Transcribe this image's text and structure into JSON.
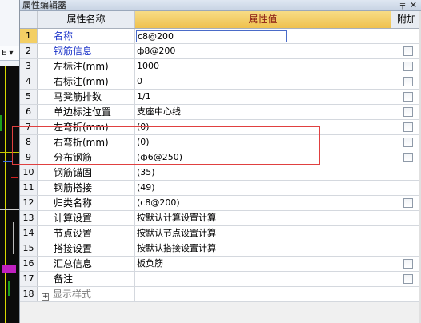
{
  "panel": {
    "title": "属性编辑器",
    "pin_icon": "pin-icon",
    "close_icon": "close-icon"
  },
  "left_strip": {
    "dropdown_label": "E ▾"
  },
  "columns": {
    "name": "属性名称",
    "value": "属性值",
    "extra": "附加"
  },
  "rows": [
    {
      "num": "1",
      "name": "名称",
      "value": "c8@200",
      "blue": true,
      "selected": true,
      "checkbox": false
    },
    {
      "num": "2",
      "name": "钢筋信息",
      "value": "ф8@200",
      "blue": true,
      "selected": false,
      "checkbox": true
    },
    {
      "num": "3",
      "name": "左标注(mm)",
      "value": "1000",
      "blue": false,
      "selected": false,
      "checkbox": true
    },
    {
      "num": "4",
      "name": "右标注(mm)",
      "value": "0",
      "blue": false,
      "selected": false,
      "checkbox": true
    },
    {
      "num": "5",
      "name": "马凳筋排数",
      "value": "1/1",
      "blue": false,
      "selected": false,
      "checkbox": true
    },
    {
      "num": "6",
      "name": "单边标注位置",
      "value": "支座中心线",
      "blue": false,
      "selected": false,
      "checkbox": true
    },
    {
      "num": "7",
      "name": "左弯折(mm)",
      "value": "(0)",
      "blue": false,
      "selected": false,
      "checkbox": true
    },
    {
      "num": "8",
      "name": "右弯折(mm)",
      "value": "(0)",
      "blue": false,
      "selected": false,
      "checkbox": true
    },
    {
      "num": "9",
      "name": "分布钢筋",
      "value": "(ф6@250)",
      "blue": false,
      "selected": false,
      "checkbox": true
    },
    {
      "num": "10",
      "name": "钢筋锚固",
      "value": "(35)",
      "blue": false,
      "selected": false,
      "checkbox": false
    },
    {
      "num": "11",
      "name": "钢筋搭接",
      "value": "(49)",
      "blue": false,
      "selected": false,
      "checkbox": false
    },
    {
      "num": "12",
      "name": "归类名称",
      "value": "(c8@200)",
      "blue": false,
      "selected": false,
      "checkbox": true
    },
    {
      "num": "13",
      "name": "计算设置",
      "value": "按默认计算设置计算",
      "blue": false,
      "selected": false,
      "checkbox": false
    },
    {
      "num": "14",
      "name": "节点设置",
      "value": "按默认节点设置计算",
      "blue": false,
      "selected": false,
      "checkbox": false
    },
    {
      "num": "15",
      "name": "搭接设置",
      "value": "按默认搭接设置计算",
      "blue": false,
      "selected": false,
      "checkbox": false
    },
    {
      "num": "16",
      "name": "汇总信息",
      "value": "板负筋",
      "blue": false,
      "selected": false,
      "checkbox": true
    },
    {
      "num": "17",
      "name": "备注",
      "value": "",
      "blue": false,
      "selected": false,
      "checkbox": true
    }
  ],
  "group_row": {
    "num": "18",
    "expand_symbol": "+",
    "name": "显示样式"
  },
  "colors": {
    "header_value_bg": "#efc14e",
    "header_value_text": "#8a1a12",
    "blue_label": "#1a32c8",
    "selected_num_bg": "#f3cf65",
    "highlight_border": "#e04040"
  }
}
